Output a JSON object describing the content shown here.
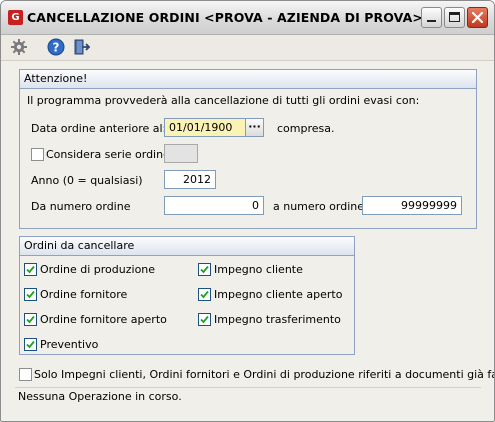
{
  "window": {
    "title": "CANCELLAZIONE ORDINI <PROVA - AZIENDA DI PROVA>",
    "app_icon_letter": "G"
  },
  "toolbar": {
    "icons": [
      "gear-icon",
      "help-icon",
      "exit-icon"
    ]
  },
  "attention": {
    "header": "Attenzione!",
    "intro": "Il programma provvederà alla cancellazione di tutti gli ordini evasi con:",
    "date_label": "Data ordine anteriore al:",
    "date_value": "01/01/1900",
    "date_button": "···",
    "date_suffix": "compresa.",
    "serie_label": "Considera serie ordine",
    "serie_checked": false,
    "serie_value": "",
    "anno_label": "Anno (0 = qualsiasi)",
    "anno_value": "2012",
    "da_label": "Da numero ordine",
    "da_value": "0",
    "a_label": "a numero ordine",
    "a_value": "99999999"
  },
  "orders": {
    "header": "Ordini da cancellare",
    "left": [
      {
        "label": "Ordine di produzione",
        "checked": true
      },
      {
        "label": "Ordine fornitore",
        "checked": true
      },
      {
        "label": "Ordine fornitore aperto",
        "checked": true
      },
      {
        "label": "Preventivo",
        "checked": true
      }
    ],
    "right": [
      {
        "label": "Impegno cliente",
        "checked": true
      },
      {
        "label": "Impegno cliente aperto",
        "checked": true
      },
      {
        "label": "Impegno trasferimento",
        "checked": true
      }
    ]
  },
  "invoiced_only": {
    "label": "Solo Impegni clienti, Ordini fornitori e Ordini di produzione riferiti a documenti già fatturati",
    "checked": false
  },
  "status": {
    "text": "Nessuna Operazione in corso."
  }
}
